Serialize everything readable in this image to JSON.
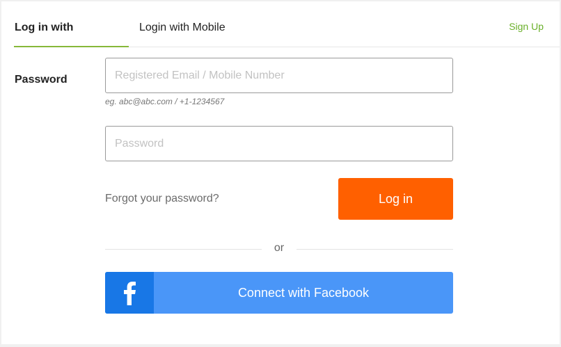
{
  "tabs": {
    "password_label": "Log in with Password",
    "mobile_label": "Login with Mobile"
  },
  "header": {
    "signup_label": "Sign Up"
  },
  "form": {
    "email_placeholder": "Registered Email / Mobile Number",
    "email_hint": "eg. abc@abc.com / +1-1234567",
    "password_placeholder": "Password",
    "forgot_label": "Forgot your password?",
    "login_label": "Log in",
    "divider_text": "or",
    "facebook_label": "Connect with Facebook",
    "facebook_icon": "facebook-f-icon"
  },
  "colors": {
    "accent_green": "#86b839",
    "signup_green": "#6ab02a",
    "login_orange": "#ff6000",
    "facebook_blue": "#4a96f8",
    "facebook_dark_blue": "#1877e6"
  }
}
